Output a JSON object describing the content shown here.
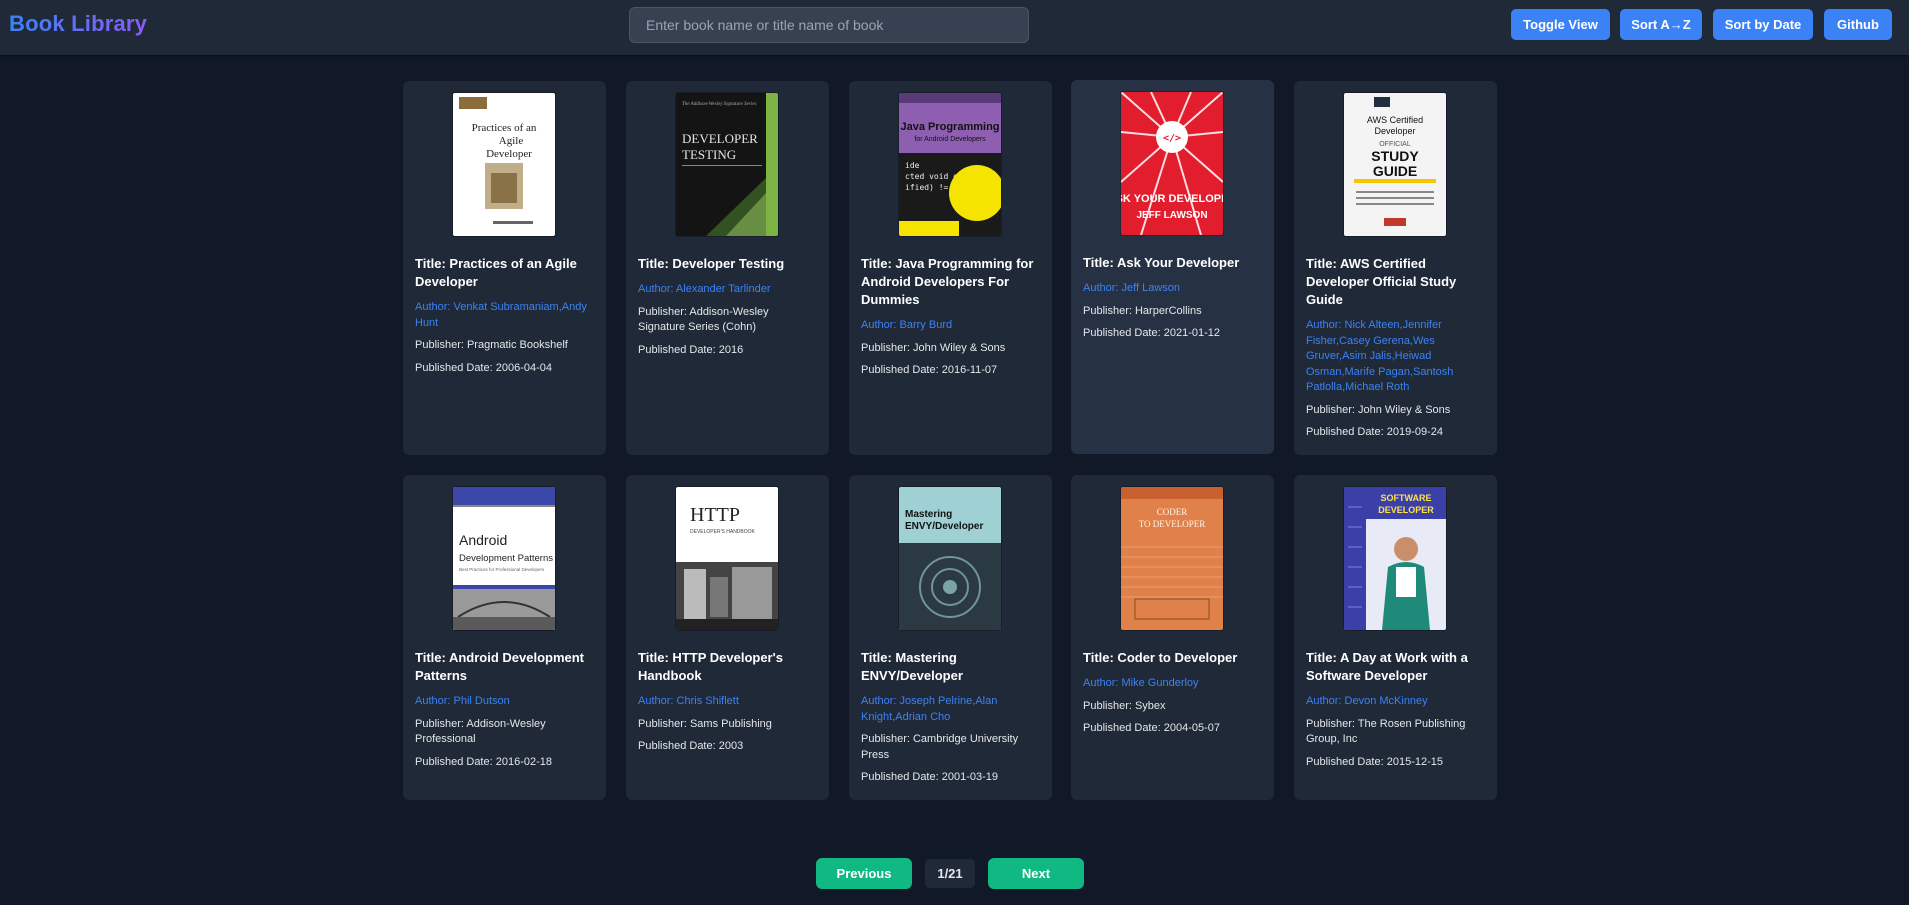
{
  "header": {
    "brand": "Book Library",
    "search_placeholder": "Enter book name or title name of book",
    "buttons": {
      "toggle_view": "Toggle View",
      "sort_az": "Sort A→Z",
      "sort_date": "Sort by Date",
      "github": "Github"
    }
  },
  "books": [
    {
      "title": "Title: Practices of an Agile Developer",
      "author": "Author: Venkat Subramaniam,Andy Hunt",
      "publisher": "Publisher: Pragmatic Bookshelf",
      "date": "Published Date: 2006-04-04",
      "cover": {
        "bg": "#ffffff",
        "fg": "#1f1f1f",
        "accent": "#8a6d3b",
        "text": "Practices of an Agile Developer"
      }
    },
    {
      "title": "Title: Developer Testing",
      "author": "Author: Alexander Tarlinder",
      "publisher": "Publisher: Addison-Wesley Signature Series (Cohn)",
      "date": "Published Date: 2016",
      "cover": {
        "bg": "#141414",
        "fg": "#e5e5e5",
        "accent": "#7cb342",
        "text": "Developer Testing"
      }
    },
    {
      "title": "Title: Java Programming for Android Developers For Dummies",
      "author": "Author: Barry Burd",
      "publisher": "Publisher: John Wiley & Sons",
      "date": "Published Date: 2016-11-07",
      "cover": {
        "bg": "#8e5fb0",
        "fg": "#111111",
        "accent": "#f5e400",
        "text": "Java Programming for Android Developers"
      }
    },
    {
      "title": "Title: Ask Your Developer",
      "author": "Author: Jeff Lawson",
      "publisher": "Publisher: HarperCollins",
      "date": "Published Date: 2021-01-12",
      "cover": {
        "bg": "#e11d2e",
        "fg": "#ffffff",
        "accent": "#ffffff",
        "text": "ASK YOUR DEVELOPER"
      }
    },
    {
      "title": "Title: AWS Certified Developer Official Study Guide",
      "author": "Author: Nick Alteen,Jennifer Fisher,Casey Gerena,Wes Gruver,Asim Jalis,Heiwad Osman,Marife Pagan,Santosh Patlolla,Michael Roth",
      "publisher": "Publisher: John Wiley & Sons",
      "date": "Published Date: 2019-09-24",
      "cover": {
        "bg": "#ffffff",
        "fg": "#111111",
        "accent": "#f7c600",
        "text": "STUDY GUIDE"
      }
    },
    {
      "title": "Title: Android Development Patterns",
      "author": "Author: Phil Dutson",
      "publisher": "Publisher: Addison-Wesley Professional",
      "date": "Published Date: 2016-02-18",
      "cover": {
        "bg": "#ffffff",
        "fg": "#222222",
        "accent": "#3a46a8",
        "text": "Android Development Patterns"
      }
    },
    {
      "title": "Title: HTTP Developer's Handbook",
      "author": "Author: Chris Shiflett",
      "publisher": "Publisher: Sams Publishing",
      "date": "Published Date: 2003",
      "cover": {
        "bg": "#ffffff",
        "fg": "#222222",
        "accent": "#555555",
        "text": "HTTP"
      }
    },
    {
      "title": "Title: Mastering ENVY/Developer",
      "author": "Author: Joseph Pelrine,Alan Knight,Adrian Cho",
      "publisher": "Publisher: Cambridge University Press",
      "date": "Published Date: 2001-03-19",
      "cover": {
        "bg": "#9fd0d4",
        "fg": "#111111",
        "accent": "#2b3a42",
        "text": "Mastering ENVY/Developer"
      }
    },
    {
      "title": "Title: Coder to Developer",
      "author": "Author: Mike Gunderloy",
      "publisher": "Publisher: Sybex",
      "date": "Published Date: 2004-05-07",
      "cover": {
        "bg": "#e0814a",
        "fg": "#fff4e6",
        "accent": "#c8602f",
        "text": "Coder To Developer"
      }
    },
    {
      "title": "Title: A Day at Work with a Software Developer",
      "author": "Author: Devon McKinney",
      "publisher": "Publisher: The Rosen Publishing Group, Inc",
      "date": "Published Date: 2015-12-15",
      "cover": {
        "bg": "#3b3fa8",
        "fg": "#ffe14d",
        "accent": "#e8eaf6",
        "text": "SOFTWARE DEVELOPER"
      }
    }
  ],
  "pagination": {
    "previous": "Previous",
    "page": "1/21",
    "next": "Next"
  },
  "colors": {
    "background": "#111827",
    "card": "#1f2937",
    "accent": "#3b82f6",
    "pagination": "#10b981"
  }
}
